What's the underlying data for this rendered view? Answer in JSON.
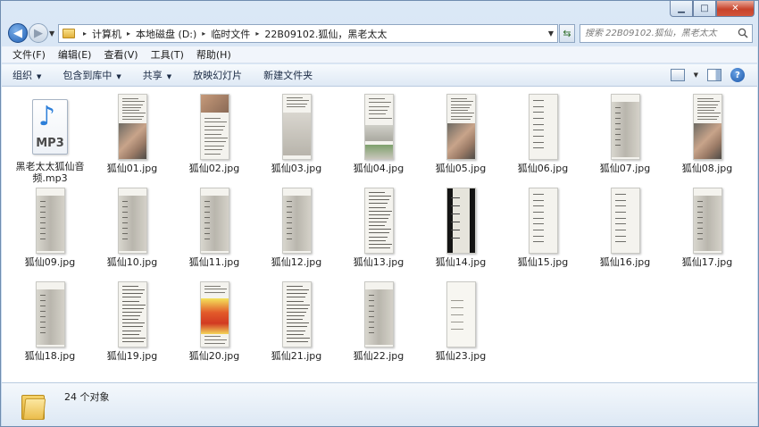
{
  "window": {
    "controls": {
      "minimize": "▁",
      "maximize": "□",
      "close": "✕"
    }
  },
  "address": {
    "breadcrumbs": [
      "计算机",
      "本地磁盘 (D:)",
      "临时文件",
      "22B09102.狐仙，黑老太太"
    ]
  },
  "search": {
    "placeholder": "搜索 22B09102.狐仙，黑老太太"
  },
  "menu": [
    "文件(F)",
    "编辑(E)",
    "查看(V)",
    "工具(T)",
    "帮助(H)"
  ],
  "commands": [
    {
      "label": "组织",
      "dropdown": true
    },
    {
      "label": "包含到库中",
      "dropdown": true
    },
    {
      "label": "共享",
      "dropdown": true
    },
    {
      "label": "放映幻灯片",
      "dropdown": false
    },
    {
      "label": "新建文件夹",
      "dropdown": false
    }
  ],
  "files": [
    {
      "name": "黑老太太狐仙音频.mp3",
      "type": "mp3"
    },
    {
      "name": "狐仙01.jpg",
      "type": "jpg",
      "photo": "hand"
    },
    {
      "name": "狐仙02.jpg",
      "type": "jpg",
      "photo": "top"
    },
    {
      "name": "狐仙03.jpg",
      "type": "jpg",
      "photo": "paper"
    },
    {
      "name": "狐仙04.jpg",
      "type": "jpg",
      "photo": "mixed"
    },
    {
      "name": "狐仙05.jpg",
      "type": "jpg",
      "photo": "hand"
    },
    {
      "name": "狐仙06.jpg",
      "type": "jpg",
      "photo": "diagram"
    },
    {
      "name": "狐仙07.jpg",
      "type": "jpg",
      "photo": "figure"
    },
    {
      "name": "狐仙08.jpg",
      "type": "jpg",
      "photo": "hand"
    },
    {
      "name": "狐仙09.jpg",
      "type": "jpg",
      "photo": "figure"
    },
    {
      "name": "狐仙10.jpg",
      "type": "jpg",
      "photo": "figure"
    },
    {
      "name": "狐仙11.jpg",
      "type": "jpg",
      "photo": "figure"
    },
    {
      "name": "狐仙12.jpg",
      "type": "jpg",
      "photo": "figure"
    },
    {
      "name": "狐仙13.jpg",
      "type": "jpg",
      "photo": "text"
    },
    {
      "name": "狐仙14.jpg",
      "type": "jpg",
      "photo": "dark"
    },
    {
      "name": "狐仙15.jpg",
      "type": "jpg",
      "photo": "diagram"
    },
    {
      "name": "狐仙16.jpg",
      "type": "jpg",
      "photo": "diagram"
    },
    {
      "name": "狐仙17.jpg",
      "type": "jpg",
      "photo": "figure"
    },
    {
      "name": "狐仙18.jpg",
      "type": "jpg",
      "photo": "figure"
    },
    {
      "name": "狐仙19.jpg",
      "type": "jpg",
      "photo": "text"
    },
    {
      "name": "狐仙20.jpg",
      "type": "jpg",
      "photo": "poster"
    },
    {
      "name": "狐仙21.jpg",
      "type": "jpg",
      "photo": "text"
    },
    {
      "name": "狐仙22.jpg",
      "type": "jpg",
      "photo": "figure"
    },
    {
      "name": "狐仙23.jpg",
      "type": "jpg",
      "photo": "sketch"
    }
  ],
  "status": {
    "count": "24 个对象"
  }
}
